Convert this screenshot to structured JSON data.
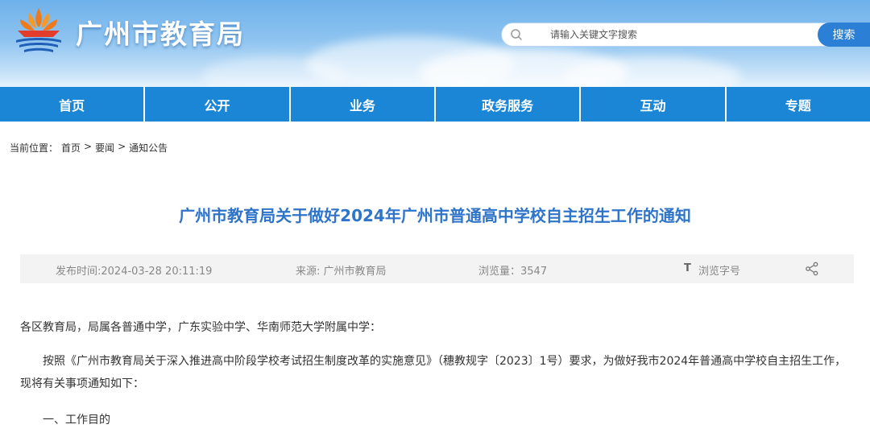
{
  "header": {
    "site_title": "广州市教育局",
    "search_placeholder": "请输入关键文字搜索",
    "search_button": "搜索"
  },
  "nav": [
    "首页",
    "公开",
    "业务",
    "政务服务",
    "互动",
    "专题"
  ],
  "breadcrumb": {
    "prefix": "当前位置：",
    "items": [
      "首页",
      "要闻",
      "通知公告"
    ],
    "separator": ">"
  },
  "article": {
    "title": "广州市教育局关于做好2024年广州市普通高中学校自主招生工作的通知",
    "meta": {
      "date": "发布时间:2024-03-28 20:11:19",
      "source": "来源: 广州市教育局",
      "views": "浏览量：3547",
      "font_icon": "T",
      "font_label": "浏览字号"
    },
    "body": {
      "salutation": "各区教育局，局属各普通中学，广东实验中学、华南师范大学附属中学：",
      "paragraph1": "按照《广州市教育局关于深入推进高中阶段学校考试招生制度改革的实施意见》（穗教规字〔2023〕1号）要求，为做好我市2024年普通高中学校自主招生工作，现将有关事项通知如下：",
      "section1": "一、工作目的"
    }
  },
  "colors": {
    "nav_bg": "#1c86d6",
    "title_blue": "#2f74c9",
    "search_btn": "#2b7fd4",
    "logo_orange": "#f07a1a",
    "logo_red": "#e23c2c"
  },
  "icons": [
    "emblem-logo-icon",
    "search-icon",
    "font-size-icon",
    "share-icon"
  ]
}
